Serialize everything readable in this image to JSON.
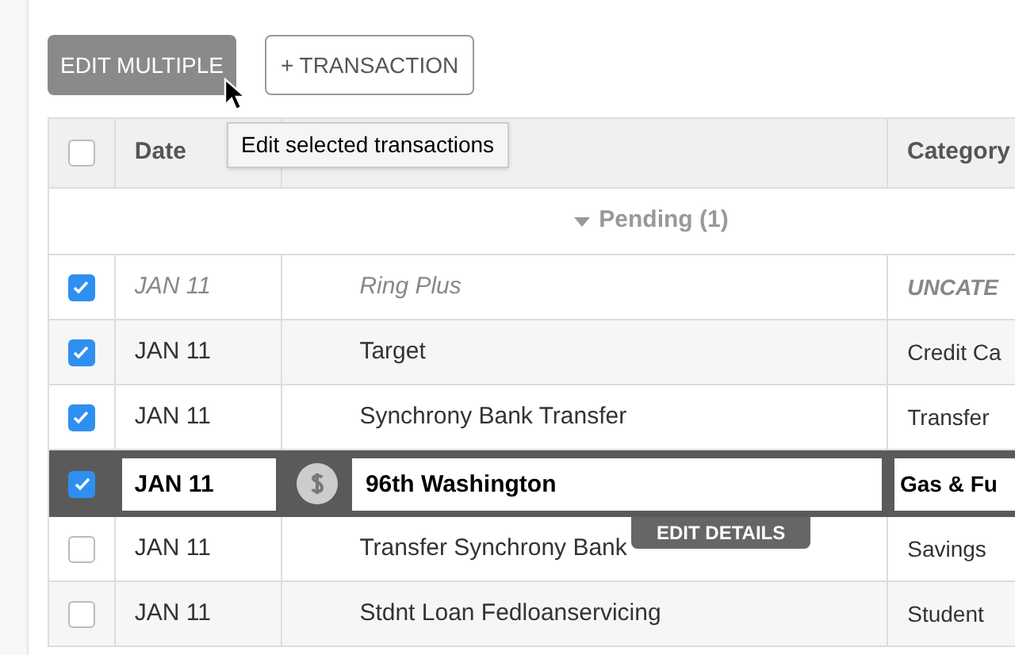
{
  "toolbar": {
    "edit_multiple": {
      "label": "EDIT MULTIPLE",
      "disabled": true
    },
    "add_transaction": {
      "label": "+ TRANSACTION"
    }
  },
  "tooltip": "Edit selected transactions",
  "table": {
    "select_all": {
      "checked": false
    },
    "columns": [
      "Date",
      "Category"
    ],
    "group": {
      "label": "Pending (1)",
      "expanded": true
    },
    "rows": [
      {
        "kind": "pending",
        "checked": true,
        "date": "JAN 11",
        "description": "Ring Plus",
        "category": "UNCATE"
      },
      {
        "kind": "normal",
        "checked": true,
        "date": "JAN 11",
        "description": "Target",
        "category": "Credit Ca"
      },
      {
        "kind": "normal",
        "checked": true,
        "date": "JAN 11",
        "description": "Synchrony Bank Transfer",
        "category": "Transfer"
      },
      {
        "kind": "editing",
        "checked": true,
        "date": "JAN 11",
        "description": "96th Washington",
        "category": "Gas & Fu",
        "action": "EDIT DETAILS"
      },
      {
        "kind": "normal",
        "checked": false,
        "date": "JAN 11",
        "description": "Transfer Synchrony Bank",
        "category": "Savings"
      },
      {
        "kind": "normal",
        "checked": false,
        "date": "JAN 11",
        "description": "Stdnt Loan Fedloanservicing",
        "category": "Student"
      }
    ]
  }
}
